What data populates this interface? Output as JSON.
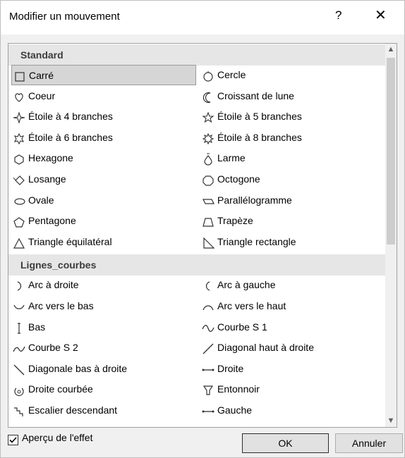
{
  "window": {
    "title": "Modifier un mouvement",
    "help": "?",
    "close": "✕"
  },
  "groups": [
    {
      "header": "Standard",
      "items": [
        {
          "label": "Carré",
          "icon": "square-icon",
          "selected": true
        },
        {
          "label": "Cercle",
          "icon": "circle-icon"
        },
        {
          "label": "Coeur",
          "icon": "heart-icon"
        },
        {
          "label": "Croissant de lune",
          "icon": "crescent-icon"
        },
        {
          "label": "Étoile à 4 branches",
          "icon": "star4-icon"
        },
        {
          "label": "Étoile à 5 branches",
          "icon": "star5-icon"
        },
        {
          "label": "Étoile à 6 branches",
          "icon": "star6-icon"
        },
        {
          "label": "Étoile à 8 branches",
          "icon": "star8-icon"
        },
        {
          "label": "Hexagone",
          "icon": "hexagon-icon"
        },
        {
          "label": "Larme",
          "icon": "teardrop-icon"
        },
        {
          "label": "Losange",
          "icon": "diamond-icon"
        },
        {
          "label": "Octogone",
          "icon": "octagon-icon"
        },
        {
          "label": "Ovale",
          "icon": "oval-icon"
        },
        {
          "label": "Parallélogramme",
          "icon": "parallelogram-icon"
        },
        {
          "label": "Pentagone",
          "icon": "pentagon-icon"
        },
        {
          "label": "Trapèze",
          "icon": "trapezoid-icon"
        },
        {
          "label": "Triangle équilatéral",
          "icon": "triangle-icon"
        },
        {
          "label": "Triangle rectangle",
          "icon": "right-triangle-icon"
        }
      ]
    },
    {
      "header": "Lignes_courbes",
      "items": [
        {
          "label": "Arc à droite",
          "icon": "arc-right-icon"
        },
        {
          "label": "Arc à gauche",
          "icon": "arc-left-icon"
        },
        {
          "label": "Arc vers le bas",
          "icon": "arc-down-icon"
        },
        {
          "label": "Arc vers le haut",
          "icon": "arc-up-icon"
        },
        {
          "label": "Bas",
          "icon": "line-down-icon"
        },
        {
          "label": "Courbe S 1",
          "icon": "s-curve1-icon"
        },
        {
          "label": "Courbe S 2",
          "icon": "s-curve2-icon"
        },
        {
          "label": "Diagonal haut à droite",
          "icon": "diag-up-right-icon"
        },
        {
          "label": "Diagonale bas à droite",
          "icon": "diag-down-right-icon"
        },
        {
          "label": "Droite",
          "icon": "line-right-icon"
        },
        {
          "label": "Droite courbée",
          "icon": "curved-right-icon"
        },
        {
          "label": "Entonnoir",
          "icon": "funnel-icon"
        },
        {
          "label": "Escalier descendant",
          "icon": "stairs-down-icon"
        },
        {
          "label": "Gauche",
          "icon": "line-left-icon"
        }
      ]
    }
  ],
  "footer": {
    "preview_label": "Aperçu de l'effet",
    "preview_checked": true,
    "ok_label": "OK",
    "cancel_label": "Annuler"
  }
}
